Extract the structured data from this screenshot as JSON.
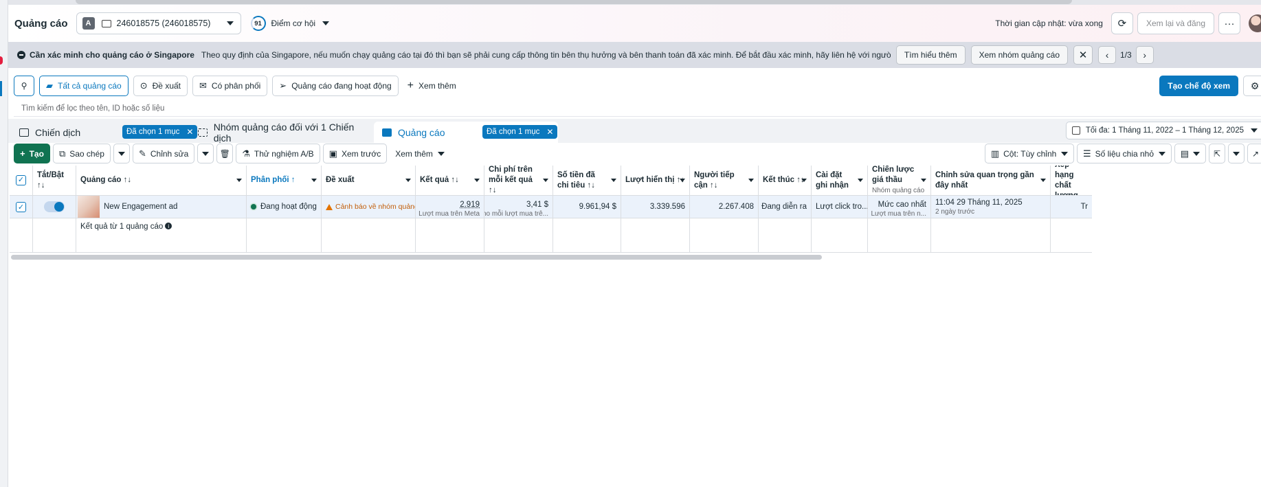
{
  "header": {
    "title": "Quảng cáo",
    "account_letter": "A",
    "account_name": "246018575 (246018575)",
    "score": "91",
    "score_label": "Điểm cơ hội",
    "updated": "Thời gian cập nhật: vừa xong",
    "review_publish": "Xem lại và đăng",
    "more": "···"
  },
  "banner": {
    "title": "Cần xác minh cho quảng cáo ở Singapore",
    "text": "Theo quy định của Singapore, nếu muốn chạy quảng cáo tại đó thì bạn sẽ phải cung cấp thông tin bên thụ hưởng và bên thanh toán đã xác minh. Để bắt đầu xác minh, hãy liên hệ với người nắm toàn quyền kiểm soát tài khoản quản...",
    "learn_more": "Tìm hiểu thêm",
    "view_adsets": "Xem nhóm quảng cáo",
    "close": "✕",
    "prev": "‹",
    "counter": "1/3",
    "next": "›"
  },
  "filters": {
    "all_ads": "Tất cả quảng cáo",
    "suggestions": "Đề xuất",
    "has_delivery": "Có phân phối",
    "active_ads": "Quảng cáo đang hoạt động",
    "see_more": "Xem thêm",
    "create_view": "Tạo chế độ xem"
  },
  "search": {
    "placeholder": "Tìm kiếm để lọc theo tên, ID hoặc số liệu"
  },
  "tabs": [
    {
      "label": "Chiến dịch",
      "chip": "Đã chọn 1 mục"
    },
    {
      "label": "Nhóm quảng cáo đối với 1 Chiến dịch"
    },
    {
      "label": "Quảng cáo",
      "chip": "Đã chọn 1 mục"
    }
  ],
  "date_range": "Tối đa: 1 Tháng 11, 2022 – 1 Tháng 12, 2025",
  "toolbar": {
    "create": "Tạo",
    "duplicate": "Sao chép",
    "edit": "Chỉnh sửa",
    "ab_test": "Thử nghiệm A/B",
    "preview": "Xem trước",
    "more": "Xem thêm",
    "columns": "Cột: Tùy chỉnh",
    "breakdown": "Số liệu chia nhỏ"
  },
  "table": {
    "headers": {
      "toggle": "Tắt/Bật ↑↓",
      "ad": "Quảng cáo ↑↓",
      "delivery": "Phân phối ↑",
      "recommendations": "Đề xuất",
      "results": "Kết quả ↑↓",
      "cost_per_result": "Chi phí trên mỗi kết quả ↑↓",
      "amount_spent": "Số tiền đã chi tiêu ↑↓",
      "impressions": "Lượt hiển thị ↑↓",
      "reach": "Người tiếp cận ↑↓",
      "ends": "Kết thúc ↑↓",
      "attribution": "Cài đặt ghi nhận",
      "bid_strategy": "Chiến lược giá thầu",
      "bid_strategy_sub": "Nhóm quảng cáo",
      "last_edit": "Chỉnh sửa quan trọng gần đây nhất",
      "quality": "Xếp hạng chất lượng"
    },
    "row": {
      "ad_name": "New Engagement ad",
      "delivery": "Đang hoạt động",
      "recommendation": "Cảnh báo về nhóm quảng cáo",
      "results": "2.919",
      "results_sub": "Lượt mua trên Meta",
      "cost_per_result": "3,41 $",
      "cost_sub": "Cho mỗi lượt mua trê...",
      "amount_spent": "9.961,94 $",
      "impressions": "3.339.596",
      "reach": "2.267.408",
      "ends": "Đang diễn ra",
      "attribution": "Lượt click tro...",
      "bid_strategy": "Mức cao nhất",
      "bid_strategy_sub": "Lượt mua trên n...",
      "last_edit": "11:04 29 Tháng 11, 2025",
      "last_edit_sub": "2 ngày trước",
      "quality": "Tr"
    },
    "summary": "Kết quả từ 1 quảng cáo"
  }
}
